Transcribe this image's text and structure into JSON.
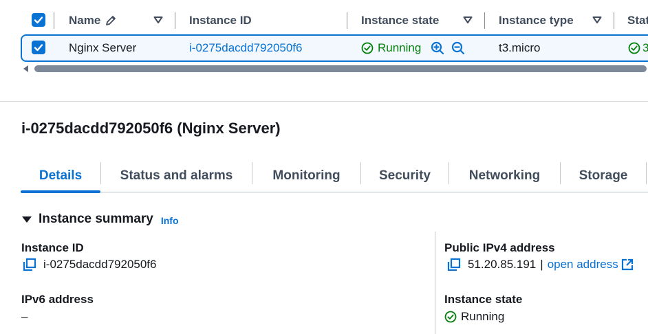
{
  "table": {
    "columns": [
      {
        "label": "Name"
      },
      {
        "label": "Instance ID"
      },
      {
        "label": "Instance state"
      },
      {
        "label": "Instance type"
      },
      {
        "label": "Stat"
      }
    ],
    "row": {
      "name": "Nginx Server",
      "instance_id": "i-0275dacdd792050f6",
      "state": "Running",
      "type": "t3.micro",
      "status_partial": "3"
    }
  },
  "detail": {
    "title": "i-0275dacdd792050f6 (Nginx Server)",
    "tabs": [
      "Details",
      "Status and alarms",
      "Monitoring",
      "Security",
      "Networking",
      "Storage"
    ],
    "active_tab": "Details",
    "summary": {
      "heading": "Instance summary",
      "info_link": "Info",
      "instance_id_label": "Instance ID",
      "instance_id_value": "i-0275dacdd792050f6",
      "ipv6_label": "IPv6 address",
      "ipv6_value": "–",
      "public_ipv4_label": "Public IPv4 address",
      "public_ipv4_value": "51.20.85.191",
      "separator": "|",
      "open_address": "open address",
      "instance_state_label": "Instance state",
      "instance_state_value": "Running"
    }
  },
  "colors": {
    "accent": "#0972d3",
    "success": "#037f0c",
    "text": "#16191f",
    "muted": "#414d5c",
    "selected_row_bg": "#f2f8fd"
  },
  "icons": [
    "checkbox-checked-icon",
    "pencil-icon",
    "sort-caret-icon",
    "status-running-icon",
    "zoom-in-icon",
    "zoom-out-icon",
    "copy-icon",
    "external-link-icon",
    "expand-caret-icon"
  ]
}
